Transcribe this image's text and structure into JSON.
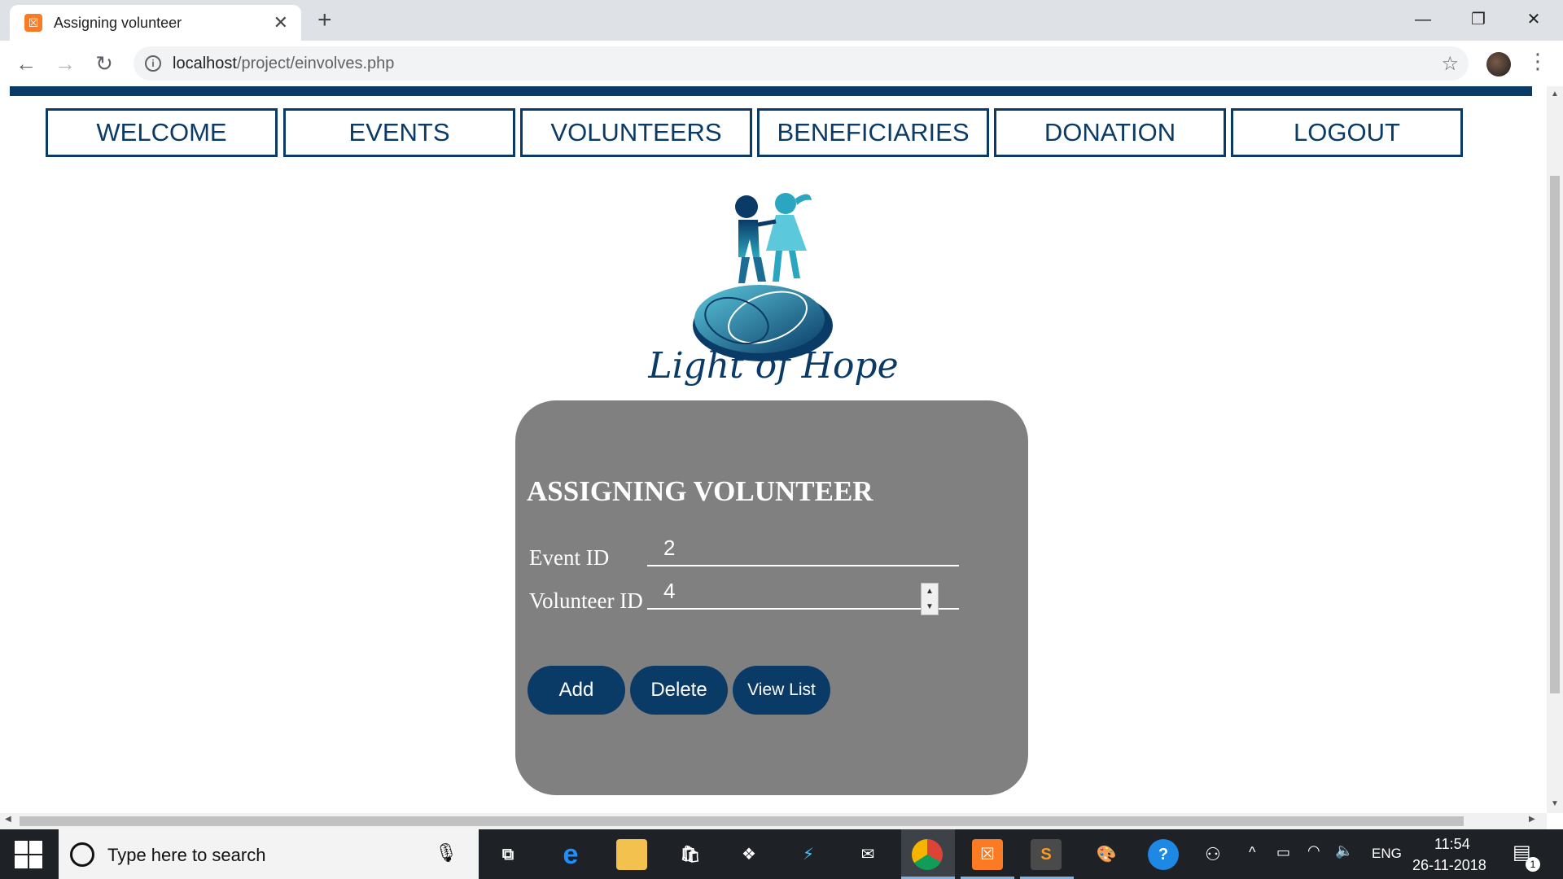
{
  "browser": {
    "tab_title": "Assigning volunteer",
    "tab_close": "✕",
    "new_tab": "+",
    "url_host": "localhost",
    "url_path": "/project/einvolves.php",
    "window": {
      "minimize": "—",
      "restore": "❐",
      "close": "✕"
    }
  },
  "nav": {
    "items": [
      {
        "label": "WELCOME"
      },
      {
        "label": "EVENTS"
      },
      {
        "label": "VOLUNTEERS"
      },
      {
        "label": "BENEFICIARIES"
      },
      {
        "label": "DONATION"
      },
      {
        "label": "LOGOUT"
      }
    ]
  },
  "logo": {
    "text": "Light of Hope"
  },
  "form": {
    "title": "ASSIGNING VOLUNTEER",
    "event_id_label": "Event ID",
    "event_id_value": "2",
    "volunteer_id_label": "Volunteer ID",
    "volunteer_id_value": "4",
    "buttons": {
      "add": "Add",
      "delete": "Delete",
      "view_list": "View List"
    }
  },
  "taskbar": {
    "search_placeholder": "Type here to search",
    "language": "ENG",
    "time": "11:54",
    "date": "26-11-2018",
    "notification_count": "1"
  },
  "colors": {
    "brand_navy": "#0a3a66",
    "panel_gray": "#808080",
    "logo_teal": "#2aa6c0"
  }
}
